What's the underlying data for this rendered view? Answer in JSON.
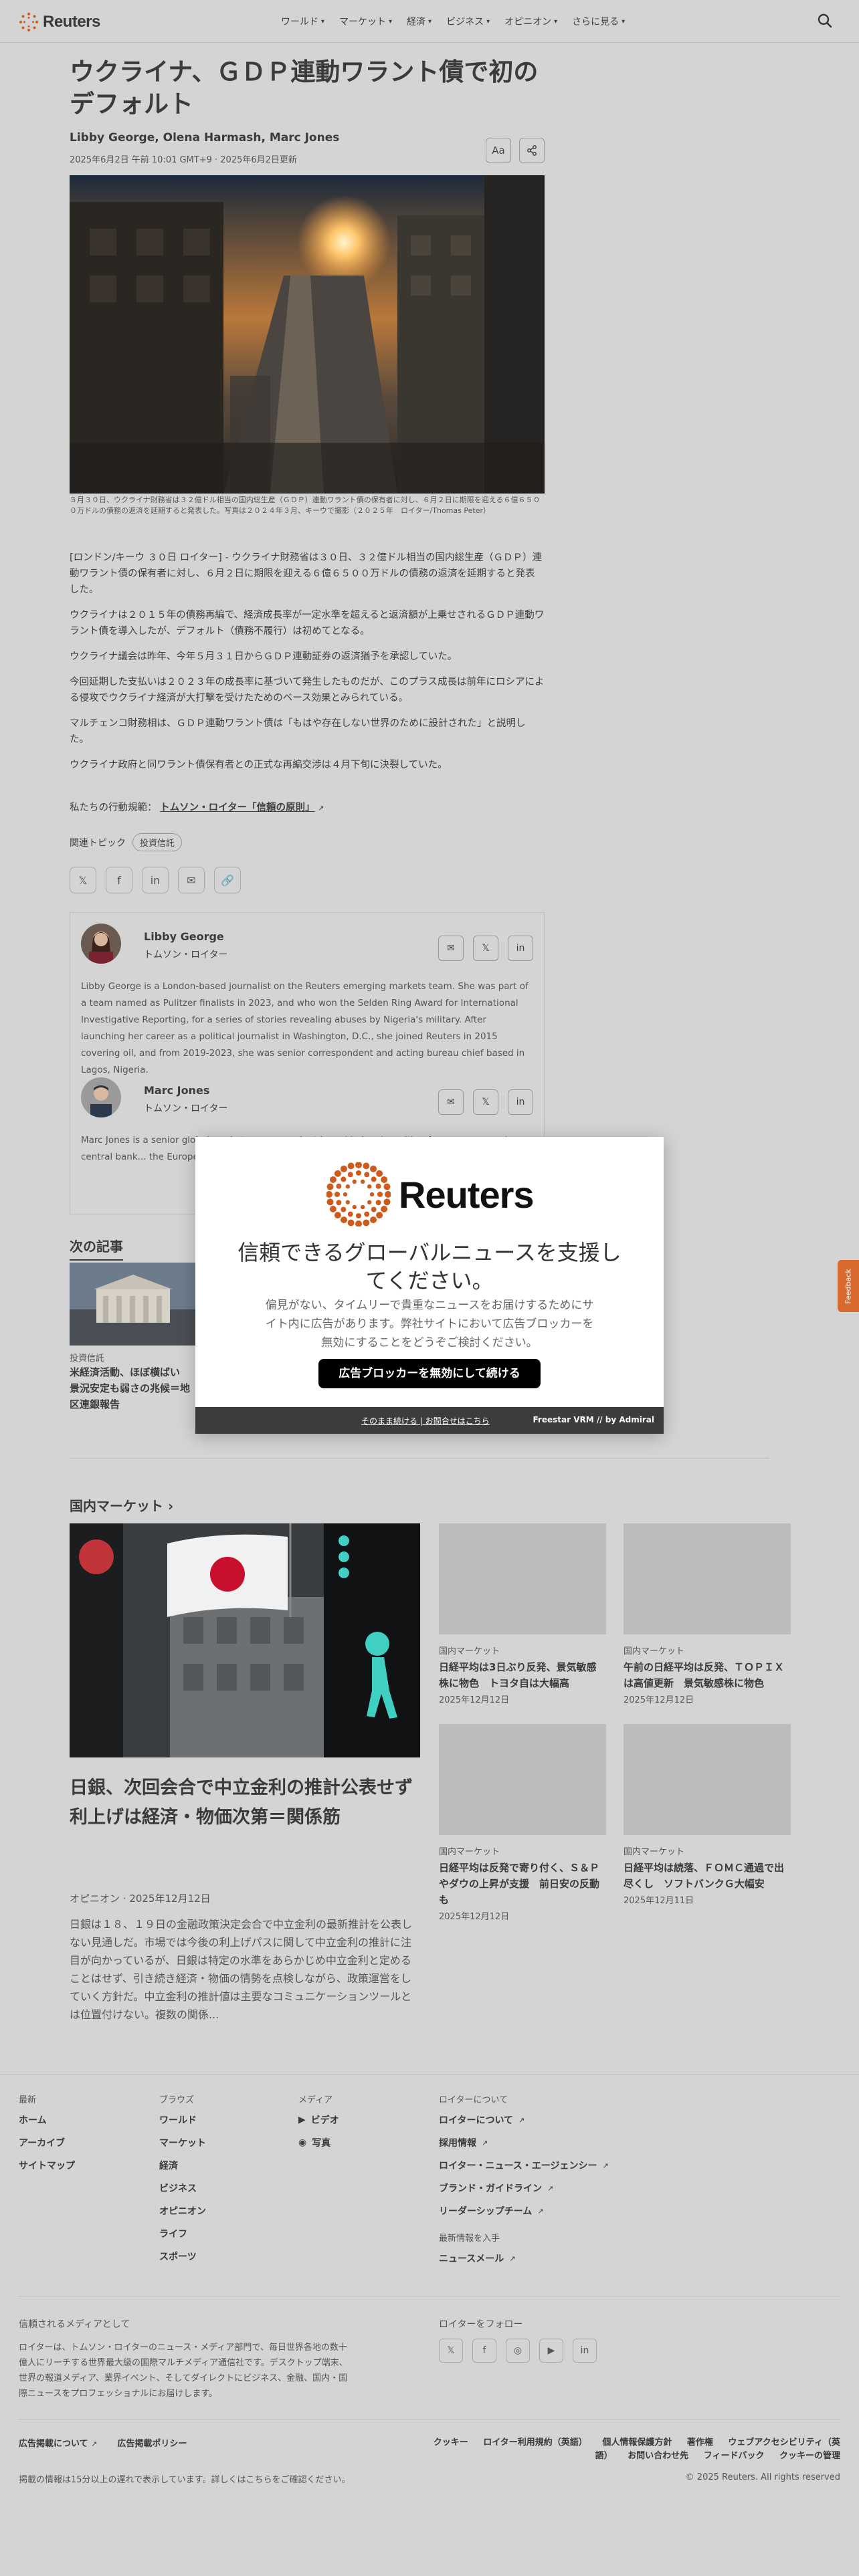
{
  "nav": {
    "brand": "Reuters",
    "items": [
      "ワールド",
      "マーケット",
      "経済",
      "ビジネス",
      "オピニオン",
      "さらに見る"
    ]
  },
  "article": {
    "headline": "ウクライナ、ＧＤＰ連動ワラント債で初のデフォルト",
    "author1": "Libby George",
    "author2": "Olena Harmash",
    "author3": "Marc Jones",
    "dateline": "2025年6月2日 午前 10:01 GMT+9 · 2025年6月2日更新",
    "text_size_label": "Aa",
    "caption": "５月３０日、ウクライナ財務省は３２億ドル相当の国内総生産（ＧＤＰ）連動ワラント債の保有者に対し、６月２日に期限を迎える６億６５００万ドルの債務の返済を延期すると発表した。写真は２０２４年３月、キーウで撮影（２０２５年　ロイター/Thomas Peter）",
    "paragraphs": [
      "[ロンドン/キーウ ３０日 ロイター] - ウクライナ財務省は３０日、３２億ドル相当の国内総生産（ＧＤＰ）連動ワラント債の保有者に対し、６月２日に期限を迎える６億６５００万ドルの債務の返済を延期すると発表した。",
      "ウクライナは２０１５年の債務再編で、経済成長率が一定水準を超えると返済額が上乗せされるＧＤＰ連動ワラント債を導入したが、デフォルト（債務不履行）は初めてとなる。",
      "ウクライナ議会は昨年、今年５月３１日からＧＤＰ連動証券の返済猶予を承認していた。",
      "今回延期した支払いは２０２３年の成長率に基づいて発生したものだが、このプラス成長は前年にロシアによる侵攻でウクライナ経済が大打撃を受けたためのベース効果とみられている。",
      "マルチェンコ財務相は、ＧＤＰ連動ワラント債は「もはや存在しない世界のために設計された」と説明した。",
      "ウクライナ政府と同ワラント債保有者との正式な再編交渉は４月下旬に決裂していた。"
    ],
    "standards_prefix": "私たちの行動規範：",
    "standards_link": "トムソン・ロイター「信頼の原則」",
    "topics_label": "関連トピック",
    "topic": "投資信託"
  },
  "authors_box": [
    {
      "name": "Libby George",
      "org": "トムソン・ロイター",
      "bio": "Libby George is a London-based journalist on the Reuters emerging markets team. She was part of a team named as Pulitzer finalists in 2023, and who won the Selden Ring Award for International Investigative Reporting, for a series of stories revealing abuses by Nigeria's military. After launching her career as a political journalist in Washington, D.C., she joined Reuters in 2015 covering oil, and from 2019-2023, she was senior correspondent and acting bureau chief based in Lagos, Nigeria."
    },
    {
      "name": "Marc Jones",
      "org": "トムソン・ロイター",
      "bio": "Marc Jones is a senior global markets correspondent based in London with a focus on economics, central bank... the European Central Ba... during the initial phase o... desk covering everythin..."
    }
  ],
  "next": {
    "heading": "次の記事",
    "tag": "投資信託",
    "title": "米経済活動、ほぼ横ばい　景況安定も弱さの兆候＝地区連銀報告"
  },
  "modal": {
    "brand": "Reuters",
    "title": "信頼できるグローバルニュースを支援してください。",
    "body": "偏見がない、タイムリーで貴重なニュースをお届けするためにサイト内に広告があります。弊社サイトにおいて広告ブロッカーを無効にすることをどうぞご検討ください。",
    "button": "広告ブロッカーを無効にして続ける",
    "footer_links": "そのまま続ける | お問合せはこちら",
    "footer_brand": "Freestar VRM  // by Admiral"
  },
  "feedback": "Feedback",
  "domestic": {
    "heading": "国内マーケット",
    "lead": {
      "title": "日銀、次回会合で中立金利の推計公表せず　利上げは経済・物価次第＝関係筋",
      "meta": "オピニオン · 2025年12月12日",
      "desc": "日銀は１８、１９日の金融政策決定会合で中立金利の最新推計を公表しない見通しだ。市場では今後の利上げパスに関して中立金利の推計に注目が向かっているが、日銀は特定の水準をあらかじめ中立金利と定めることはせず、引き続き経済・物価の情勢を点検しながら、政策運営をしていく方針だ。中立金利の推計値は主要なコミュニケーションツールとは位置付けない。複数の関係..."
    },
    "cards": [
      {
        "tag": "国内マーケット",
        "title": "日経平均は3日ぶり反発、景気敏感株に物色　トヨタ自は大幅高",
        "date": "2025年12月12日"
      },
      {
        "tag": "国内マーケット",
        "title": "午前の日経平均は反発、ＴＯＰＩＸは高値更新　景気敏感株に物色",
        "date": "2025年12月12日"
      },
      {
        "tag": "国内マーケット",
        "title": "日経平均は反発で寄り付く、Ｓ＆Ｐやダウの上昇が支援　前日安の反動も",
        "date": "2025年12月12日"
      },
      {
        "tag": "国内マーケット",
        "title": "日経平均は続落、ＦＯＭＣ通過で出尽くし　ソフトバンクＧ大幅安",
        "date": "2025年12月11日"
      }
    ]
  },
  "footer": {
    "col1": [
      "最新",
      "ホーム",
      "アーカイブ",
      "サイトマップ"
    ],
    "col2_head": "ブラウズ",
    "col2": [
      "ワールド",
      "マーケット",
      "経済",
      "ビジネス",
      "オピニオン",
      "ライフ",
      "スポーツ"
    ],
    "col3_head": "メディア",
    "col3": [
      "ビデオ",
      "写真"
    ],
    "col4_head": "ロイターについて",
    "col4": [
      "ロイターについて",
      "採用情報",
      "ロイター・ニュース・エージェンシー",
      "ブランド・ガイドライン",
      "リーダーシップチーム"
    ],
    "latest_head": "最新情報を入手",
    "newsletter": "ニュースメール",
    "trusted_head": "信頼されるメディアとして",
    "trusted": "ロイターは、トムソン・ロイターのニュース・メディア部門で、毎日世界各地の数十億人にリーチする世界最大級の国際マルチメディア通信社です。デスクトップ端末、世界の報道メディア、業界イベント、そしてダイレクトにビジネス、金融、国内・国際ニュースをプロフェッショナルにお届けします。",
    "follow_head": "ロイターをフォロー",
    "legal_left": [
      "広告掲載について",
      "広告掲載ポリシー"
    ],
    "legal_right": [
      "クッキー",
      "ロイター利用規約（英語）",
      "個人情報保護方針",
      "著作権",
      "ウェブアクセシビリティ（英語）",
      "お問い合わせ先",
      "フィードバック",
      "クッキーの管理"
    ],
    "delay": "掲載の情報は15分以上の遅れで表示しています。詳しくはこちらをご確認ください。",
    "copyright": "© 2025 Reuters. All rights reserved"
  },
  "colors": {
    "accent": "#d05a1b",
    "modal_button": "#000000",
    "modal_footer": "#3c3c3c"
  }
}
